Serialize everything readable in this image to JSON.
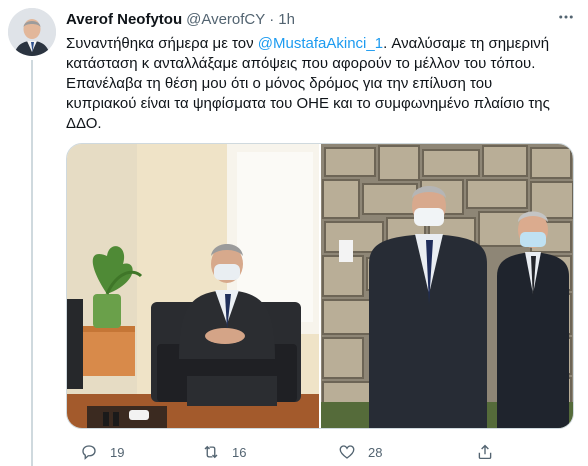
{
  "tweet": {
    "author_name": "Averof Neofytou",
    "author_handle": "@AverofCY",
    "separator": "·",
    "time": "1h",
    "text_lines": [
      {
        "before": "Συναντήθηκα σήμερα με τον ",
        "mention": "@MustafaAkinci_1",
        "after": ". Αναλύσαμε τη σημερινή"
      },
      {
        "before": "κατάσταση κ ανταλλάξαμε απόψεις που αφορούν το μέλλον του τόπου.",
        "mention": "",
        "after": ""
      },
      {
        "before": "Επανέλαβα τη θέση μου ότι ο μόνος δρόμος για την επίλυση του",
        "mention": "",
        "after": ""
      },
      {
        "before": "κυπριακού είναι τα ψηφίσματα του ΟΗΕ και το συμφωνημένο πλαίσιο της",
        "mention": "",
        "after": ""
      },
      {
        "before": "ΔΔΟ.",
        "mention": "",
        "after": ""
      }
    ],
    "actions": {
      "replies": "19",
      "retweets": "16",
      "likes": "28"
    },
    "colors": {
      "link": "#1d9bf0",
      "secondary": "#536471",
      "border": "#cfd9de"
    },
    "icons": [
      "more-icon",
      "reply-icon",
      "retweet-icon",
      "like-icon",
      "share-icon"
    ]
  }
}
